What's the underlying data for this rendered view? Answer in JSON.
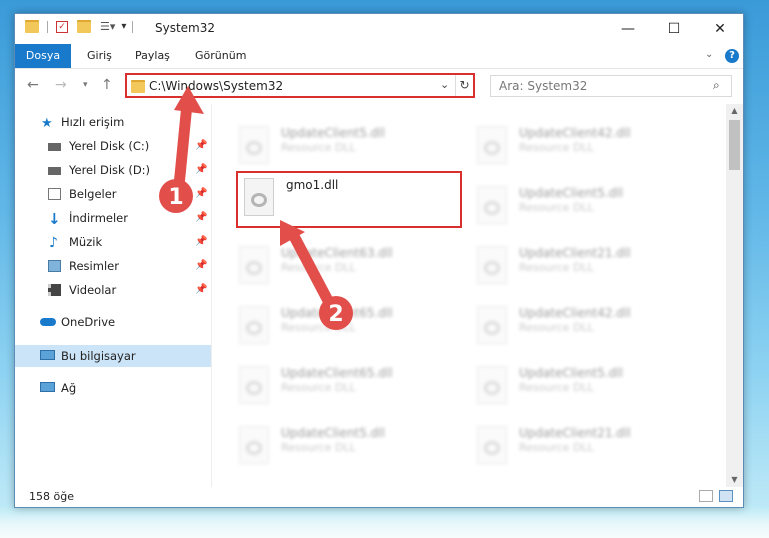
{
  "window": {
    "title": "System32",
    "controls": {
      "minimize": "—",
      "maximize": "☐",
      "close": "✕"
    }
  },
  "ribbon": {
    "tabs": [
      {
        "label": "Dosya",
        "active": true
      },
      {
        "label": "Giriş"
      },
      {
        "label": "Paylaş"
      },
      {
        "label": "Görünüm"
      }
    ],
    "help_label": "?"
  },
  "address": {
    "path": "C:\\Windows\\System32",
    "search_placeholder": "Ara: System32"
  },
  "nav": {
    "items": [
      {
        "label": "Hızlı erişim",
        "icon": "star-icon"
      },
      {
        "label": "Yerel Disk (C:)",
        "icon": "drive-icon",
        "pinned": true
      },
      {
        "label": "Yerel Disk (D:)",
        "icon": "drive-icon",
        "pinned": true
      },
      {
        "label": "Belgeler",
        "icon": "documents-icon",
        "pinned": true
      },
      {
        "label": "İndirmeler",
        "icon": "download-icon",
        "pinned": true
      },
      {
        "label": "Müzik",
        "icon": "music-icon",
        "pinned": true
      },
      {
        "label": "Resimler",
        "icon": "pictures-icon",
        "pinned": true
      },
      {
        "label": "Videolar",
        "icon": "videos-icon",
        "pinned": true
      },
      {
        "label": "OneDrive",
        "icon": "cloud-icon"
      },
      {
        "label": "Bu bilgisayar",
        "icon": "computer-icon",
        "selected": true
      },
      {
        "label": "Ağ",
        "icon": "network-icon"
      }
    ]
  },
  "files": {
    "highlighted": {
      "name": "gmo1.dll",
      "type": ""
    },
    "left_column": [
      {
        "name": "UpdateClient5.dll",
        "type": "Resource DLL"
      },
      {
        "name": "UpdateClient63.dll",
        "type": "Resource DLL"
      },
      {
        "name": "UpdateClient65.dll",
        "type": "Resource DLL"
      },
      {
        "name": "UpdateClient65.dll",
        "type": "Resource DLL"
      },
      {
        "name": "UpdateClient5.dll",
        "type": "Resource DLL"
      }
    ],
    "right_column": [
      {
        "name": "UpdateClient42.dll",
        "type": "Resource DLL"
      },
      {
        "name": "UpdateClient5.dll",
        "type": "Resource DLL"
      },
      {
        "name": "UpdateClient21.dll",
        "type": "Resource DLL"
      },
      {
        "name": "UpdateClient42.dll",
        "type": "Resource DLL"
      },
      {
        "name": "UpdateClient5.dll",
        "type": "Resource DLL"
      },
      {
        "name": "UpdateClient21.dll",
        "type": "Resource DLL"
      }
    ]
  },
  "status": {
    "item_count": "158 öğe"
  },
  "annotations": {
    "step1": "1",
    "step2": "2"
  },
  "colors": {
    "accent": "#1979ca",
    "annotation_red": "#d9302e",
    "selected_bg": "#cce4f7"
  }
}
